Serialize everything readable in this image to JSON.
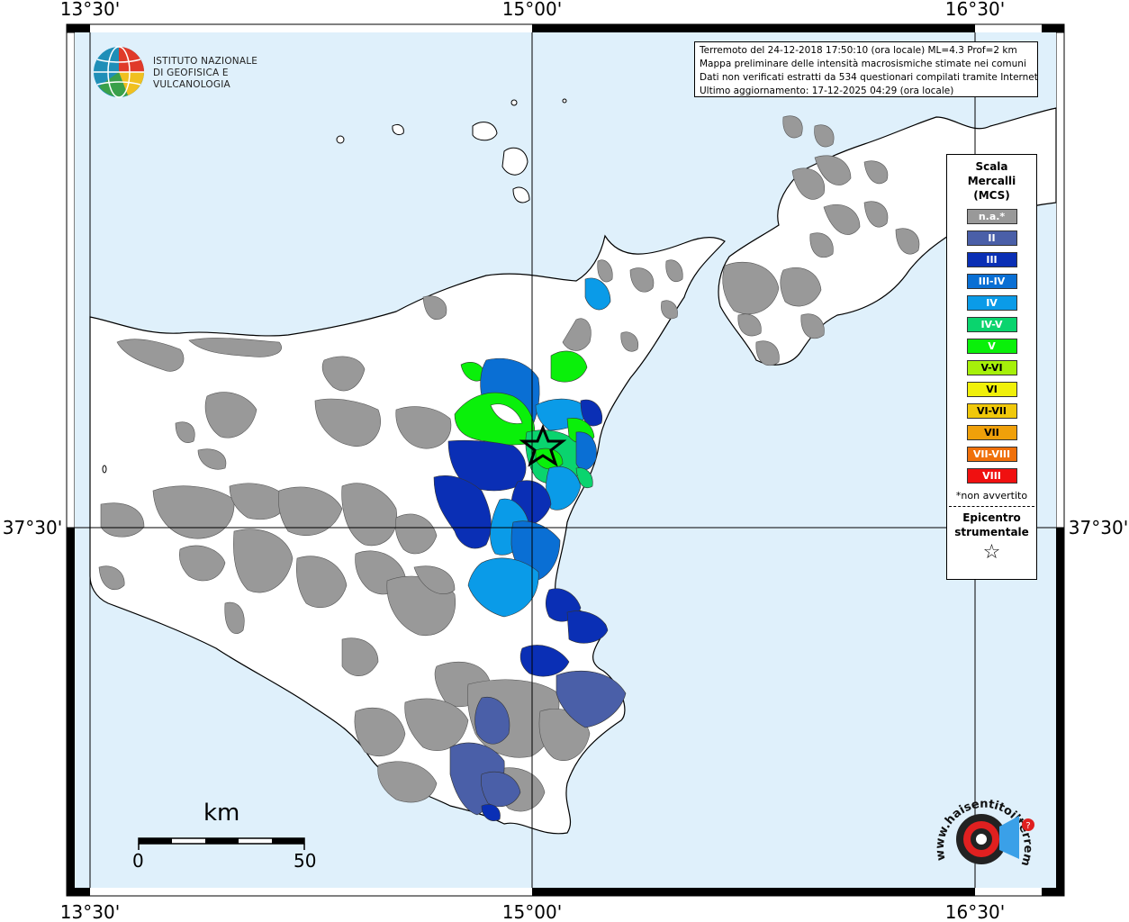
{
  "coords": {
    "lon_left": "13°30'",
    "lon_center": "15°00'",
    "lon_right": "16°30'",
    "lat_mid": "37°30'"
  },
  "info_box": {
    "line1": "Terremoto del 24-12-2018 17:50:10 (ora locale) ML=4.3 Prof=2 km",
    "line2": "Mappa preliminare delle intensità macrosismiche stimate nei comuni",
    "line3": "Dati non verificati estratti da 534 questionari compilati tramite Internet.",
    "line4": "Ultimo aggiornamento: 17-12-2025 04:29 (ora locale)"
  },
  "ingv": {
    "line1": "ISTITUTO NAZIONALE",
    "line2": "DI GEOFISICA E VULCANOLOGIA"
  },
  "legend": {
    "title_line1": "Scala",
    "title_line2": "Mercalli",
    "title_line3": "(MCS)",
    "items": [
      {
        "label": "n.a.*",
        "color": "#999999"
      },
      {
        "label": "II",
        "color": "#4a5fa8"
      },
      {
        "label": "III",
        "color": "#0a2fb5"
      },
      {
        "label": "III-IV",
        "color": "#0a6fd4"
      },
      {
        "label": "IV",
        "color": "#0a9be8"
      },
      {
        "label": "IV-V",
        "color": "#0ad46e"
      },
      {
        "label": "V",
        "color": "#0af00a"
      },
      {
        "label": "V-VI",
        "color": "#a6f00a"
      },
      {
        "label": "VI",
        "color": "#f0f00a"
      },
      {
        "label": "VI-VII",
        "color": "#f0c80a"
      },
      {
        "label": "VII",
        "color": "#f0a00a"
      },
      {
        "label": "VII-VIII",
        "color": "#f0700a"
      },
      {
        "label": "VIII",
        "color": "#f01010"
      }
    ],
    "note": "*non avvertito",
    "epicenter_line1": "Epicentro",
    "epicenter_line2": "strumentale",
    "epicenter_symbol": "☆"
  },
  "scale_bar": {
    "unit": "km",
    "min": "0",
    "max": "50"
  },
  "hsit_logo": {
    "text": "www.haisentitoilterremoto.it",
    "icon": "megaphone-icon"
  },
  "colors": {
    "sea": "#dff0fb",
    "land": "#ffffff",
    "na": "#999999"
  }
}
